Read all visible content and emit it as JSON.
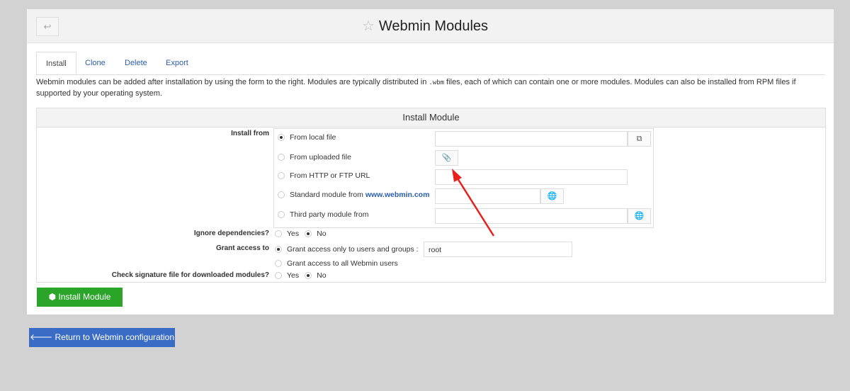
{
  "header": {
    "back_icon": "arrow-return-icon",
    "star_icon": "star-icon",
    "title": "Webmin Modules"
  },
  "tabs": [
    {
      "label": "Install",
      "active": true
    },
    {
      "label": "Clone"
    },
    {
      "label": "Delete"
    },
    {
      "label": "Export"
    }
  ],
  "description": {
    "part1": "Webmin modules can be added after installation by using the form to the right. Modules are typically distributed in ",
    "code": ".wbm",
    "part2": " files, each of which can contain one or more modules. Modules can also be installed from RPM files if supported by your operating system."
  },
  "form": {
    "title": "Install Module",
    "install_from_label": "Install from",
    "sources": [
      {
        "label": "From local file",
        "selected": true,
        "value": ""
      },
      {
        "label": "From uploaded file",
        "selected": false
      },
      {
        "label": "From HTTP or FTP URL",
        "selected": false,
        "value": ""
      },
      {
        "label": "Standard module from ",
        "link": "www.webmin.com",
        "selected": false,
        "value": ""
      },
      {
        "label": "Third party module from",
        "selected": false,
        "value": ""
      }
    ],
    "ignore_deps_label": "Ignore dependencies?",
    "ignore_deps": {
      "yes": "Yes",
      "no": "No",
      "selected": "No"
    },
    "grant_label": "Grant access to",
    "grant_only": "Grant access only to users and groups :",
    "grant_value": "root",
    "grant_all": "Grant access to all Webmin users",
    "sig_label": "Check signature file for downloaded modules?",
    "sig": {
      "yes": "Yes",
      "no": "No",
      "selected": "No"
    }
  },
  "buttons": {
    "install": "Install Module",
    "return": "Return to Webmin configuration"
  },
  "colors": {
    "install": "#2aa52a",
    "return": "#3a6cc6",
    "annotation_arrow": "#e8201c"
  }
}
